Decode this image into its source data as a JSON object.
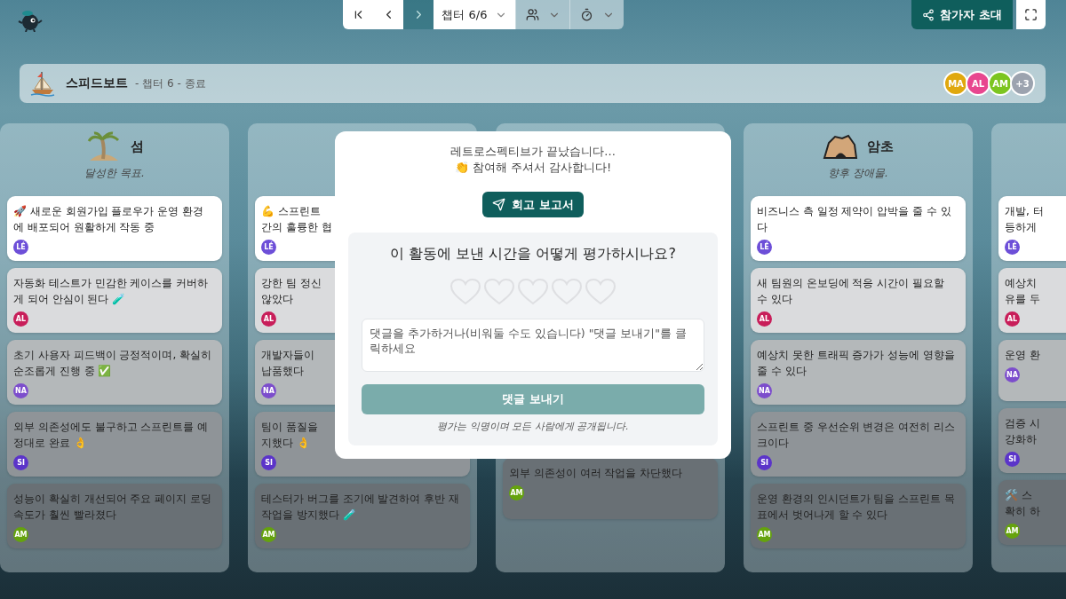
{
  "topbar": {
    "nav_buttons": [
      {
        "kind": "first",
        "disabled": false
      },
      {
        "kind": "prev",
        "disabled": false
      },
      {
        "kind": "next",
        "disabled": true
      }
    ],
    "chapter": "챕터 6/6",
    "invite": "참가자 초대"
  },
  "board_header": {
    "title": "스피드보트",
    "subtitle": "- 챕터 6 - 종료",
    "participants": [
      {
        "initials": "MA",
        "color": "#e0a80e"
      },
      {
        "initials": "AL",
        "color": "#e8468f"
      },
      {
        "initials": "AM",
        "color": "#7cc520"
      }
    ],
    "more": "+3"
  },
  "columns": [
    {
      "kind": "island",
      "title": "섬",
      "subtitle": "달성한 목표.",
      "cards": [
        {
          "text": "🚀 새로운 회원가입 플로우가 운영 환경에 배포되어 원활하게 작동 중",
          "author": {
            "initials": "LÉ",
            "color": "#6d4fd8"
          }
        },
        {
          "text": "자동화 테스트가 민감한 케이스를 커버하게 되어 안심이 된다 🧪",
          "author": {
            "initials": "AL",
            "color": "#c81e5a"
          }
        },
        {
          "text": "초기 사용자 피드백이 긍정적이며, 확실히 순조롭게 진행 중 ✅",
          "author": {
            "initials": "NA",
            "color": "#7c4dcc"
          }
        },
        {
          "text": "외부 의존성에도 불구하고 스프린트를 예정대로 완료 👌",
          "author": {
            "initials": "SI",
            "color": "#5b34c9"
          }
        },
        {
          "text": "성능이 확실히 개선되어 주요 페이지 로딩 속도가 훨씬 빨라졌다",
          "author": {
            "initials": "AM",
            "color": "#65a30d"
          }
        }
      ]
    },
    {
      "cards": [
        {
          "text": "💪 스프린트\n간의 훌륭한 협",
          "author": {
            "initials": "LÉ",
            "color": "#6d4fd8"
          }
        },
        {
          "text": "강한 팀 정신\n않았다",
          "author": {
            "initials": "AL",
            "color": "#c81e5a"
          }
        },
        {
          "text": "개발자들이\n납품했다",
          "author": {
            "initials": "NA",
            "color": "#7c4dcc"
          }
        },
        {
          "text": "팀이 품질을\n지했다 👌",
          "author": {
            "initials": "SI",
            "color": "#5b34c9"
          }
        },
        {
          "text": "테스터가 버그를 조기에 발견하여 후반 재작업을 방지했다 🧪",
          "author": {
            "initials": "AM",
            "color": "#65a30d"
          }
        }
      ]
    },
    {
      "cards": [
        {
          "text": "외부 의존성이 여러 작업을 차단했다",
          "author": {
            "initials": "AM",
            "color": "#65a30d"
          }
        }
      ]
    },
    {
      "kind": "rock",
      "title": "암초",
      "subtitle": "향후 장애물.",
      "cards": [
        {
          "text": "비즈니스 측 일정 제약이 압박을 줄 수 있다",
          "author": {
            "initials": "LÉ",
            "color": "#6d4fd8"
          }
        },
        {
          "text": "새 팀원의 온보딩에 적응 시간이 필요할 수 있다",
          "author": {
            "initials": "AL",
            "color": "#c81e5a"
          }
        },
        {
          "text": "예상치 못한 트래픽 증가가 성능에 영향을 줄 수 있다",
          "author": {
            "initials": "NA",
            "color": "#7c4dcc"
          }
        },
        {
          "text": "스프린트 중 우선순위 변경은 여전히 리스크이다",
          "author": {
            "initials": "SI",
            "color": "#5b34c9"
          }
        },
        {
          "text": "운영 환경의 인시던트가 팀을 스프린트 목표에서 벗어나게 할 수 있다",
          "author": {
            "initials": "AM",
            "color": "#65a30d"
          }
        }
      ]
    },
    {
      "cards": [
        {
          "text": "개발, 터\n등하게",
          "author": {
            "initials": "LÉ",
            "color": "#6d4fd8"
          }
        },
        {
          "text": "예상치\n유를 두",
          "author": {
            "initials": "AL",
            "color": "#c81e5a"
          }
        },
        {
          "text": "운영 환",
          "author": {
            "initials": "NA",
            "color": "#7c4dcc"
          }
        },
        {
          "text": "검증 시\n강화하",
          "author": {
            "initials": "SI",
            "color": "#5b34c9"
          }
        },
        {
          "text": "🛠️ 스\n확히 하",
          "author": {
            "initials": "AM",
            "color": "#65a30d"
          }
        }
      ]
    }
  ],
  "modal": {
    "line_1": "레트로스펙티브가 끝났습니다...",
    "line_2": "👏 참여해 주셔서 감사합니다!",
    "report_button": "회고 보고서",
    "rating": {
      "question": "이 활동에 보낸 시간을 어떻게 평가하시나요?",
      "stars": 0
    },
    "comment": {
      "placeholder": "댓글을 추가하거나(비워둘 수도 있습니다) \"댓글 보내기\"를 클릭하세요"
    },
    "submit": {
      "label": "댓글 보내기",
      "disabled": true
    },
    "note": "평가는 익명이며 모든 사람에게 공개됩니다."
  }
}
